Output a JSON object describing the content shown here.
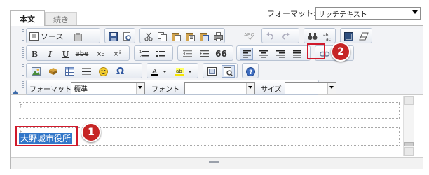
{
  "tabs": [
    {
      "label": "本文",
      "active": true
    },
    {
      "label": "続き",
      "active": false
    }
  ],
  "header": {
    "format_label": "フォーマット:",
    "format_value": "リッチテキスト"
  },
  "toolbar": {
    "row1": {
      "source_label": "ソース",
      "buttons": [
        "source",
        "paste-as-text",
        "save",
        "preview",
        "cut",
        "copy",
        "paste",
        "paste-text",
        "paste-word",
        "print",
        "spellcheck",
        "undo",
        "redo",
        "find",
        "replace",
        "select-all",
        "remove-format"
      ]
    },
    "row2": {
      "bold": "B",
      "italic": "I",
      "underline": "U",
      "strike": "abe",
      "subscript": "×₂",
      "superscript": "×²",
      "blockquote": "66"
    },
    "row4": {
      "format_label": "フォーマット",
      "format_value": "標準",
      "font_label": "フォント",
      "font_value": "",
      "size_label": "サイズ",
      "size_value": ""
    }
  },
  "content": {
    "para1_tag": "P",
    "para2_tag": "P",
    "selected_text": "大野城市役所"
  },
  "callouts": {
    "one": "1",
    "two": "2"
  },
  "colors": {
    "highlight": "#d0192b",
    "badge": "#c62525",
    "selection": "#3176c8"
  }
}
